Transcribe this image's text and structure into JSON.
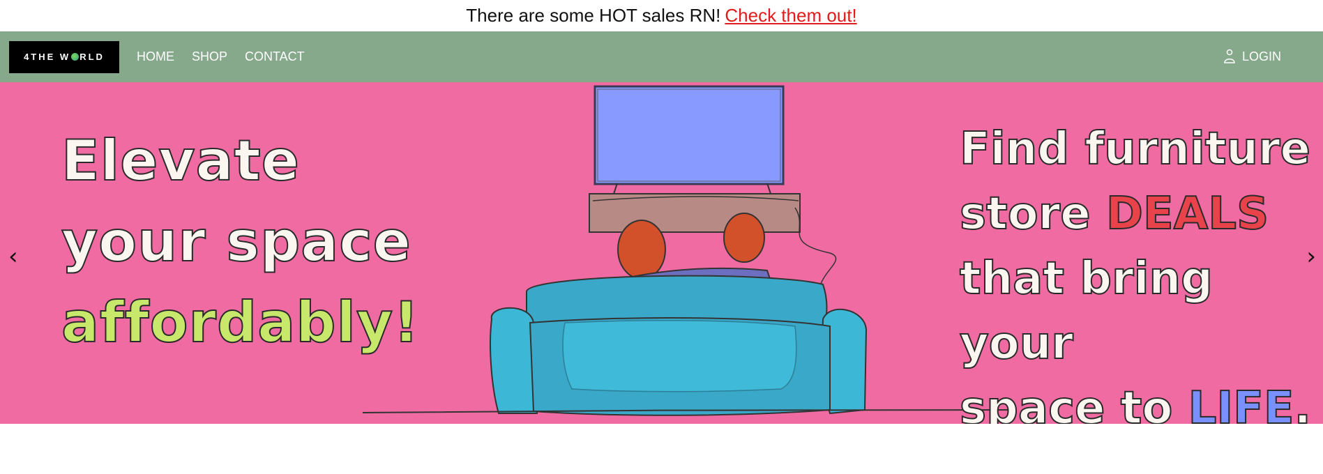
{
  "promo": {
    "text": "There are some HOT sales RN!",
    "link_label": "Check them out!"
  },
  "nav": {
    "logo_text_a": "4THE W",
    "logo_text_b": "RLD",
    "links": [
      {
        "label": "HOME"
      },
      {
        "label": "SHOP"
      },
      {
        "label": "CONTACT"
      }
    ],
    "login_label": "LOGIN"
  },
  "hero": {
    "left_lines": [
      "Elevate",
      "your space",
      "affordably!"
    ],
    "right": {
      "line1": "Find furniture",
      "line2_a": "store ",
      "line2_b": "DEALS",
      "line3": "that bring your",
      "line4_a": "space to ",
      "line4_b": "LIFE",
      "line4_c": "."
    },
    "prev_symbol": "‹",
    "next_symbol": "›"
  },
  "colors": {
    "nav_bg": "#86a98c",
    "hero_bg": "#ef6ba1",
    "promo_link": "#e01b1b",
    "accent_green": "#c7e86a",
    "accent_red": "#e8434b",
    "accent_blue": "#7a90ff"
  },
  "icons": {
    "login": "user-icon",
    "prev": "chevron-left-icon",
    "next": "chevron-right-icon"
  }
}
